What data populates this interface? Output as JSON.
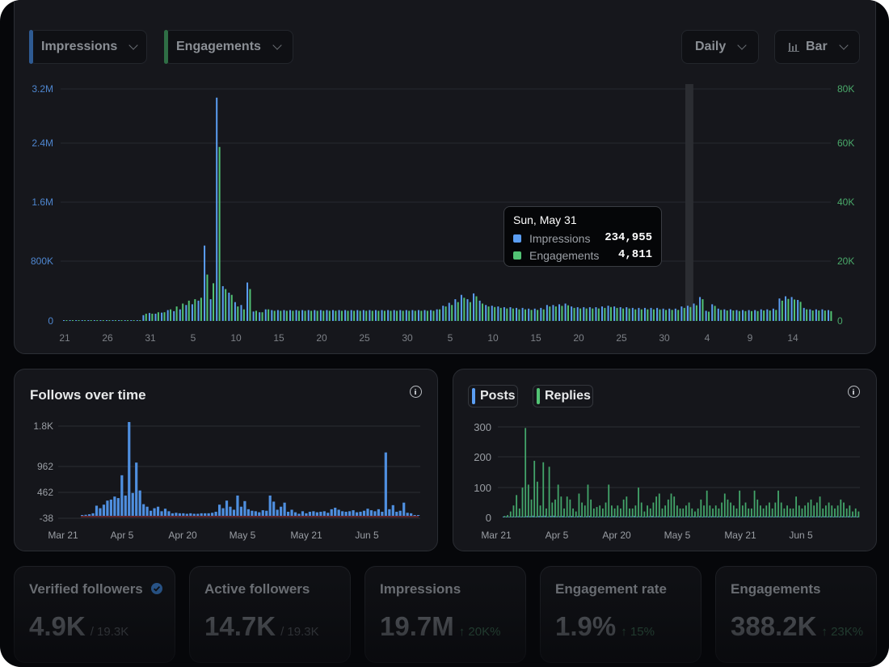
{
  "colors": {
    "impressions": "#5b9ef3",
    "engagements": "#52c374",
    "follows": "#4f8fdf",
    "posts": "#5e8fd7",
    "replies": "#43a56a"
  },
  "controls": {
    "impressions_label": "Impressions",
    "engagements_label": "Engagements",
    "interval_label": "Daily",
    "chart_type_label": "Bar",
    "bar_icon": "bar-chart-icon",
    "chevron_icon": "chevron-down-icon"
  },
  "tooltip": {
    "date": "Sun, May 31",
    "impressions_label": "Impressions",
    "impressions_value": "234,955",
    "engagements_label": "Engagements",
    "engagements_value": "4,811"
  },
  "follows_panel": {
    "title": "Follows over time",
    "info_icon": "info-icon"
  },
  "posts_panel": {
    "posts_label": "Posts",
    "replies_label": "Replies",
    "info_icon": "info-icon"
  },
  "stats": [
    {
      "title": "Verified followers",
      "value": "4.9K",
      "sub": "/ 19.3K",
      "delta": "",
      "verified_icon": "verified-badge-icon"
    },
    {
      "title": "Active followers",
      "value": "14.7K",
      "sub": "/ 19.3K",
      "delta": ""
    },
    {
      "title": "Impressions",
      "value": "19.7M",
      "sub": "",
      "delta": "↑ 20K%"
    },
    {
      "title": "Engagement rate",
      "value": "1.9%",
      "sub": "",
      "delta": "↑ 15%"
    },
    {
      "title": "Engagements",
      "value": "388.2K",
      "sub": "",
      "delta": "↑ 23K%"
    }
  ],
  "chart_data": [
    {
      "type": "bar",
      "name": "impressions-engagements",
      "x_tick_labels": [
        "21",
        "26",
        "31",
        "5",
        "10",
        "15",
        "20",
        "25",
        "30",
        "5",
        "10",
        "15",
        "20",
        "25",
        "30",
        "4",
        "9",
        "14"
      ],
      "y_left_ticks": [
        "3.2M",
        "2.4M",
        "1.6M",
        "800K",
        "0"
      ],
      "y_right_ticks": [
        "80K",
        "60K",
        "40K",
        "20K",
        "0"
      ],
      "ylim_left": [
        0,
        3200000
      ],
      "ylim_right": [
        0,
        80000
      ],
      "series": [
        {
          "name": "Impressions",
          "axis": "left",
          "values": [
            8000,
            8000,
            8000,
            8000,
            8000,
            8000,
            8000,
            8000,
            8000,
            8000,
            8000,
            8000,
            8000,
            80000,
            110000,
            100000,
            115000,
            150000,
            135000,
            160000,
            220000,
            230000,
            280000,
            1040000,
            300000,
            3080000,
            480000,
            390000,
            260000,
            220000,
            530000,
            130000,
            120000,
            160000,
            150000,
            150000,
            150000,
            150000,
            150000,
            150000,
            150000,
            150000,
            150000,
            150000,
            150000,
            150000,
            150000,
            150000,
            150000,
            150000,
            150000,
            150000,
            150000,
            150000,
            150000,
            150000,
            150000,
            150000,
            150000,
            150000,
            150000,
            160000,
            210000,
            250000,
            300000,
            360000,
            300000,
            380000,
            280000,
            220000,
            210000,
            200000,
            190000,
            190000,
            180000,
            180000,
            170000,
            170000,
            180000,
            220000,
            220000,
            230000,
            240000,
            200000,
            190000,
            190000,
            190000,
            190000,
            200000,
            210000,
            200000,
            190000,
            190000,
            180000,
            180000,
            180000,
            180000,
            180000,
            170000,
            170000,
            170000,
            200000,
            210000,
            240000,
            330000,
            140000,
            230000,
            170000,
            160000,
            160000,
            150000,
            150000,
            150000,
            150000,
            160000,
            160000,
            170000,
            310000,
            340000,
            330000,
            290000,
            180000,
            160000,
            160000,
            160000,
            150000
          ],
          "highlight_index": 102
        },
        {
          "name": "Engagements",
          "axis": "right",
          "values": [
            200,
            200,
            200,
            200,
            200,
            200,
            200,
            200,
            200,
            200,
            200,
            200,
            200,
            2500,
            2500,
            3000,
            3000,
            4000,
            5000,
            6000,
            7000,
            7500,
            8000,
            16000,
            13000,
            60000,
            11000,
            9000,
            5000,
            4000,
            11000,
            3500,
            3000,
            4000,
            3500,
            3500,
            3500,
            3500,
            3500,
            3500,
            3500,
            3500,
            3500,
            3500,
            3500,
            3500,
            3500,
            3500,
            3500,
            3500,
            3500,
            3500,
            3500,
            3500,
            3500,
            3500,
            3500,
            3500,
            3500,
            3500,
            3500,
            4000,
            5000,
            5500,
            6500,
            8000,
            6500,
            8500,
            6000,
            5000,
            4800,
            4500,
            4300,
            4300,
            4000,
            4000,
            3800,
            3800,
            4000,
            5000,
            5000,
            5200,
            5400,
            4500,
            4300,
            4300,
            4300,
            4300,
            4500,
            4800,
            4500,
            4300,
            4300,
            4000,
            4000,
            4000,
            4000,
            4000,
            3800,
            3800,
            3800,
            4500,
            4800,
            5400,
            7500,
            3200,
            5200,
            3800,
            3600,
            3600,
            3400,
            3400,
            3400,
            3400,
            3600,
            3600,
            3800,
            7000,
            7600,
            7400,
            6600,
            4000,
            3600,
            3600,
            3600,
            3400
          ]
        }
      ]
    },
    {
      "type": "bar",
      "name": "follows-over-time",
      "title": "Follows over time",
      "x_tick_labels": [
        "Mar 21",
        "Apr 5",
        "Apr 20",
        "May 5",
        "May 21",
        "Jun 5"
      ],
      "y_ticks": [
        "1.8K",
        "962",
        "462",
        "-38"
      ],
      "ylim": [
        -38,
        1850
      ],
      "series": [
        {
          "name": "Follows",
          "values": [
            10,
            20,
            30,
            50,
            200,
            150,
            220,
            300,
            320,
            380,
            350,
            800,
            400,
            1850,
            450,
            1050,
            500,
            230,
            180,
            100,
            150,
            180,
            90,
            140,
            90,
            50,
            60,
            50,
            50,
            40,
            50,
            40,
            40,
            50,
            50,
            50,
            60,
            80,
            220,
            150,
            300,
            180,
            120,
            400,
            180,
            290,
            130,
            100,
            90,
            70,
            110,
            100,
            400,
            280,
            120,
            180,
            260,
            80,
            120,
            70,
            40,
            90,
            50,
            80,
            90,
            70,
            80,
            90,
            60,
            130,
            160,
            120,
            90,
            80,
            90,
            110,
            70,
            80,
            100,
            140,
            110,
            90,
            130,
            80,
            1250,
            130,
            210,
            80,
            100,
            260,
            60,
            50,
            10,
            10
          ]
        }
      ]
    },
    {
      "type": "bar",
      "name": "posts-replies",
      "x_tick_labels": [
        "Mar 21",
        "Apr 5",
        "Apr 20",
        "May 5",
        "May 21",
        "Jun 5"
      ],
      "y_ticks": [
        "300",
        "200",
        "100",
        "0"
      ],
      "ylim": [
        0,
        320
      ],
      "series": [
        {
          "name": "Posts",
          "values": [
            3,
            3,
            2,
            3,
            3,
            4,
            3,
            3,
            5,
            4,
            6,
            3,
            5,
            5,
            6,
            3,
            5,
            6,
            4,
            4,
            5,
            3,
            4,
            5,
            3,
            4,
            5,
            3,
            4,
            5,
            3,
            3,
            3,
            4,
            3,
            4,
            3,
            5,
            4,
            3,
            4,
            4,
            3,
            4,
            5,
            3,
            4,
            3,
            3,
            4,
            5,
            3,
            4,
            3,
            4,
            3,
            4,
            4,
            3,
            4,
            3,
            3,
            4,
            3,
            4,
            3,
            4,
            3,
            4,
            3,
            4,
            4,
            3,
            4,
            3,
            4,
            3,
            4,
            3,
            4,
            3,
            4,
            4,
            3,
            4,
            3,
            4,
            3,
            4,
            3,
            4,
            3,
            4,
            3,
            4,
            3,
            4,
            3,
            4,
            3,
            4,
            3,
            4,
            3,
            4,
            3,
            4,
            3,
            4,
            3,
            4,
            3,
            4,
            3,
            4,
            3,
            4,
            3,
            4,
            3
          ]
        },
        {
          "name": "Replies",
          "values": [
            5,
            8,
            20,
            40,
            75,
            30,
            100,
            300,
            110,
            60,
            190,
            120,
            40,
            185,
            30,
            170,
            50,
            60,
            110,
            70,
            30,
            70,
            60,
            30,
            20,
            80,
            50,
            40,
            110,
            60,
            30,
            35,
            40,
            30,
            50,
            110,
            40,
            30,
            40,
            30,
            60,
            70,
            30,
            30,
            40,
            100,
            50,
            20,
            40,
            30,
            50,
            70,
            80,
            30,
            40,
            60,
            80,
            70,
            40,
            30,
            30,
            40,
            50,
            30,
            20,
            30,
            60,
            40,
            90,
            40,
            30,
            40,
            30,
            50,
            80,
            60,
            50,
            40,
            30,
            90,
            40,
            50,
            30,
            30,
            90,
            60,
            40,
            30,
            40,
            50,
            30,
            50,
            90,
            50,
            30,
            40,
            30,
            30,
            70,
            40,
            30,
            40,
            50,
            60,
            40,
            50,
            70,
            30,
            40,
            50,
            40,
            30,
            40,
            60,
            50,
            30,
            40,
            20,
            30,
            20
          ]
        }
      ]
    }
  ]
}
